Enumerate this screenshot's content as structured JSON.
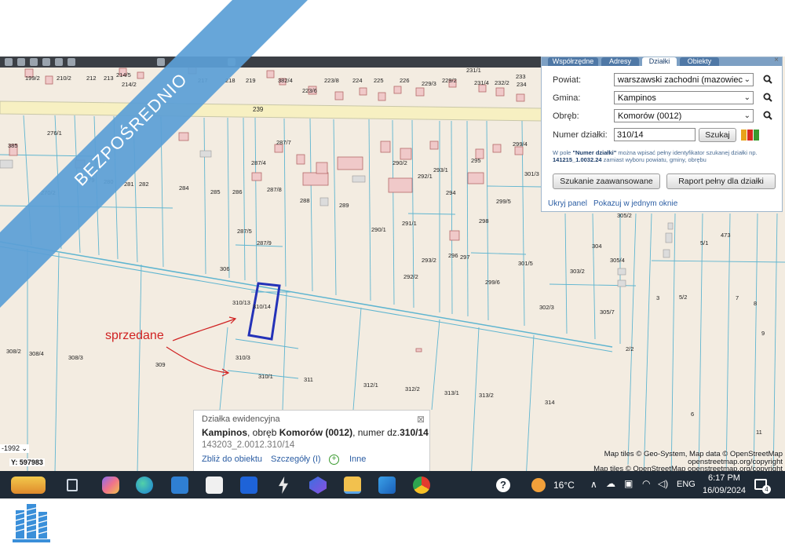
{
  "app": {
    "title": "Geoportal map – Działka ewidencyjna"
  },
  "toolbar": {
    "icons": [
      "print-icon",
      "layers-icon",
      "measure-icon",
      "bookmark-icon",
      "info-icon",
      "zoom-icon",
      "edit-icon",
      "share-icon"
    ]
  },
  "panel": {
    "tabs": [
      "Współrzędne",
      "Adresy",
      "Działki",
      "Obiekty"
    ],
    "active_tab": "Działki",
    "powiat_label": "Powiat:",
    "powiat_value": "warszawski zachodni (mazowiec",
    "gmina_label": "Gmina:",
    "gmina_value": "Kampinos",
    "obreb_label": "Obręb:",
    "obreb_value": "Komorów (0012)",
    "numer_label": "Numer działki:",
    "numer_value": "310/14",
    "search_button": "Szukaj",
    "hint_prefix": "W pole ",
    "hint_bold": "\"Numer działki\"",
    "hint_middle": " można wpisać pełny identyfikator szukanej działki np. ",
    "hint_example": "141215_1.0032.24",
    "hint_suffix": " zamiast wyboru powiatu, gminy, obrębu",
    "advanced_button": "Szukanie zaawansowane",
    "report_button": "Raport pełny dla działki",
    "hide_link": "Ukryj panel",
    "single_window_link": "Pokazuj w jednym oknie",
    "close": "×",
    "color_swatches": [
      "#e8a31a",
      "#d92b1e",
      "#3a9a2f"
    ]
  },
  "map": {
    "road_label": "239",
    "parcels": [
      "199/2",
      "210/2",
      "212",
      "213",
      "214/5",
      "214/2",
      "217",
      "218",
      "219",
      "382/4",
      "223/8",
      "224",
      "225",
      "226",
      "229/3",
      "229/2",
      "231/1",
      "231/4",
      "232/2",
      "233",
      "234",
      "385",
      "276/1",
      "270/2",
      "279",
      "280",
      "281",
      "282",
      "284",
      "285",
      "286",
      "287/4",
      "287/7",
      "287/8",
      "288",
      "289",
      "290/2",
      "290/1",
      "291/1",
      "292/1",
      "293/1",
      "294",
      "295",
      "298",
      "299/4",
      "299/5",
      "301/3",
      "305/2",
      "287/5",
      "287/9",
      "293/2",
      "296",
      "297",
      "292/2",
      "299/6",
      "301/5",
      "303/2",
      "304",
      "305/4",
      "473",
      "5/1",
      "306",
      "310/13",
      "310/14",
      "302/3",
      "305/7",
      "3",
      "5/2",
      "7",
      "8",
      "9",
      "2/2",
      "308/2",
      "308/4",
      "308/3",
      "309",
      "310/3",
      "310/1",
      "311",
      "312/1",
      "312/2",
      "313/1",
      "313/2",
      "314",
      "6",
      "11",
      "223/6"
    ],
    "selected_parcel": "310/14",
    "annotation": "sprzedane",
    "attribution_line1": "Map tiles © Geo-System, Map data © OpenStreetMap",
    "attribution_line2": "openstreetmap.org/copyright",
    "attribution_line3": "Map tiles © OpenStreetMap openstreetmap.org/copyright",
    "coord_x_label": "-1992",
    "coord_y": "Y: 597983"
  },
  "infobox": {
    "title": "Działka ewidencyjna",
    "gmina": "Kampinos",
    "obreb_text": ", obręb ",
    "obreb": "Komorów (0012)",
    "numer_text": ", numer dz.",
    "numer": "310/14",
    "identifier": "143203_2.0012.310/14",
    "zoom_link": "Zbliż do obiektu",
    "details_link": "Szczegóły (I)",
    "other_link": "Inne",
    "close": "⊠"
  },
  "taskbar": {
    "apps": [
      "widgets-icon",
      "task-view-icon",
      "copilot-icon",
      "edge-icon",
      "mail-icon",
      "store-icon",
      "dropbox-icon",
      "lightning-icon",
      "photos-icon",
      "file-explorer-icon",
      "image-icon",
      "chrome-icon"
    ],
    "help_icon": "help-icon",
    "weather_temp": "16°C",
    "language": "ENG",
    "time": "6:17 PM",
    "date": "16/09/2024",
    "notification_count": "4"
  },
  "banner": {
    "text": "BEZPOŚREDNIO",
    "color": "#5b9fd6"
  },
  "logo": {
    "name": "building-logo-icon",
    "color": "#3a8fd9"
  }
}
